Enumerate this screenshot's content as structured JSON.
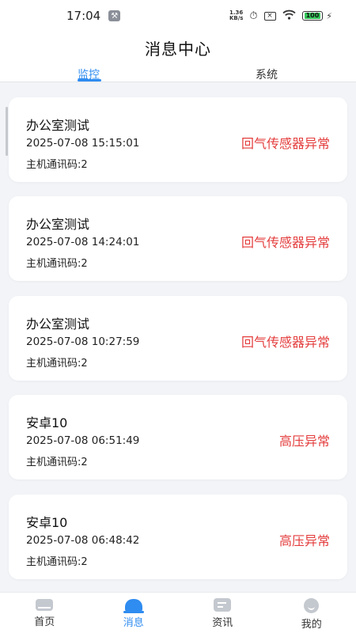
{
  "status_bar": {
    "time": "17:04",
    "net_speed_value": "1.36",
    "net_speed_unit": "KB/s",
    "battery": "100"
  },
  "header": {
    "title": "消息中心",
    "tabs": [
      {
        "label": "监控",
        "active": true
      },
      {
        "label": "系统",
        "active": false
      }
    ]
  },
  "messages": [
    {
      "title": "办公室测试",
      "time": "2025-07-08 15:15:01",
      "code": "主机通讯码:2",
      "status": "回气传感器异常"
    },
    {
      "title": "办公室测试",
      "time": "2025-07-08 14:24:01",
      "code": "主机通讯码:2",
      "status": "回气传感器异常"
    },
    {
      "title": "办公室测试",
      "time": "2025-07-08 10:27:59",
      "code": "主机通讯码:2",
      "status": "回气传感器异常"
    },
    {
      "title": "安卓10",
      "time": "2025-07-08 06:51:49",
      "code": "主机通讯码:2",
      "status": "高压异常"
    },
    {
      "title": "安卓10",
      "time": "2025-07-08 06:48:42",
      "code": "主机通讯码:2",
      "status": "高压异常"
    }
  ],
  "bottom_nav": [
    {
      "label": "首页",
      "icon": "home-icon"
    },
    {
      "label": "消息",
      "icon": "message-icon",
      "active": true
    },
    {
      "label": "资讯",
      "icon": "news-icon"
    },
    {
      "label": "我的",
      "icon": "mine-icon"
    }
  ],
  "colors": {
    "accent": "#2f8cf0",
    "alert": "#e43d3d",
    "background": "#f2f4f7"
  }
}
